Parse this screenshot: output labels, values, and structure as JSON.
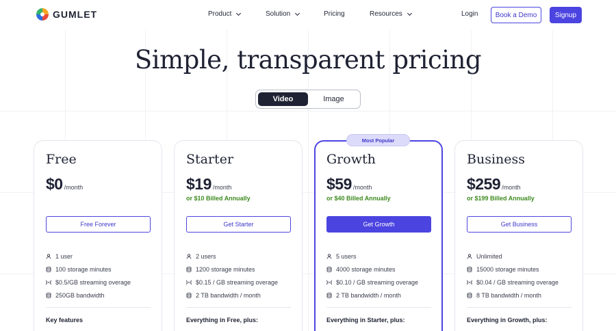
{
  "brand": {
    "name": "GUMLET"
  },
  "nav": {
    "items": [
      {
        "label": "Product",
        "dropdown": true
      },
      {
        "label": "Solution",
        "dropdown": true
      },
      {
        "label": "Pricing",
        "dropdown": false
      },
      {
        "label": "Resources",
        "dropdown": true
      }
    ],
    "login": "Login",
    "demo": "Book a Demo",
    "signup": "Signup"
  },
  "hero": {
    "title": "Simple, transparent pricing"
  },
  "toggle": {
    "options": [
      "Video",
      "Image"
    ],
    "selected": "Video"
  },
  "badge": "Most Popular",
  "plans": [
    {
      "name": "Free",
      "price": "$0",
      "per": "/month",
      "billed": "",
      "cta": "Free Forever",
      "features": [
        "1 user",
        "100 storage minutes",
        "$0.5/GB streaming overage",
        "250GB bandwidth"
      ],
      "extra": "Key features"
    },
    {
      "name": "Starter",
      "price": "$19",
      "per": "/month",
      "billed": "or $10 Billed Annually",
      "cta": "Get Starter",
      "features": [
        "2 users",
        "1200 storage minutes",
        "$0.15 / GB streaming overage",
        "2 TB bandwidth / month"
      ],
      "extra": "Everything in Free, plus:"
    },
    {
      "name": "Growth",
      "price": "$59",
      "per": "/month",
      "billed": "or $40 Billed Annually",
      "cta": "Get Growth",
      "features": [
        "5 users",
        "4000 storage minutes",
        "$0.10 / GB streaming overage",
        "2 TB bandwidth / month"
      ],
      "extra": "Everything in Starter, plus:"
    },
    {
      "name": "Business",
      "price": "$259",
      "per": "/month",
      "billed": "or $199 Billed Annually",
      "cta": "Get Business",
      "features": [
        "Unlimited",
        "15000 storage minutes",
        "$0.04 / GB streaming overage",
        "8 TB bandwidth / month"
      ],
      "extra": "Everything in Growth, plus:"
    }
  ],
  "colors": {
    "accent": "#4b44e0",
    "billed": "#3d8a1f",
    "text": "#1f2233"
  }
}
